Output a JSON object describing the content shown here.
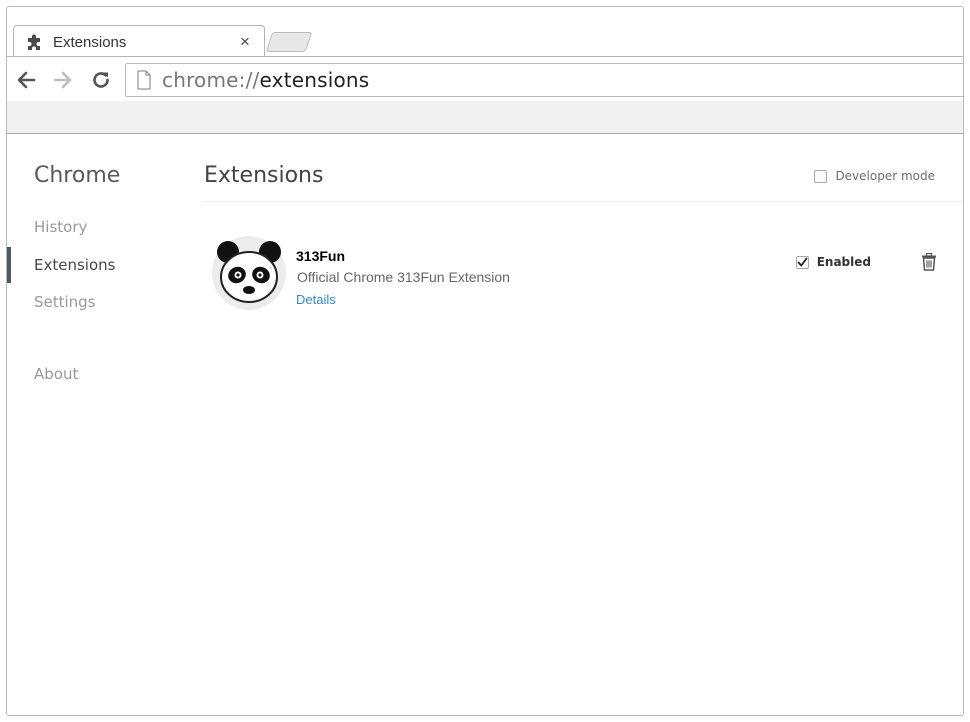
{
  "tab": {
    "title": "Extensions",
    "icon": "puzzle-piece-icon",
    "close_label": "×"
  },
  "toolbar": {
    "url_scheme": "chrome://",
    "url_path": "extensions"
  },
  "sidebar": {
    "title": "Chrome",
    "items": [
      {
        "label": "History",
        "active": false
      },
      {
        "label": "Extensions",
        "active": true
      },
      {
        "label": "Settings",
        "active": false
      },
      {
        "label": "About",
        "active": false
      }
    ]
  },
  "main": {
    "title": "Extensions",
    "developer_mode_label": "Developer mode",
    "developer_mode_checked": false
  },
  "extension": {
    "name": "313Fun",
    "description": "Official Chrome 313Fun Extension",
    "details_label": "Details",
    "enabled_label": "Enabled",
    "enabled": true,
    "icon": "panda-icon"
  },
  "colors": {
    "link": "#3a85c6",
    "active_indicator": "#4e5764",
    "toolbar_bg": "#f1f1f1"
  }
}
